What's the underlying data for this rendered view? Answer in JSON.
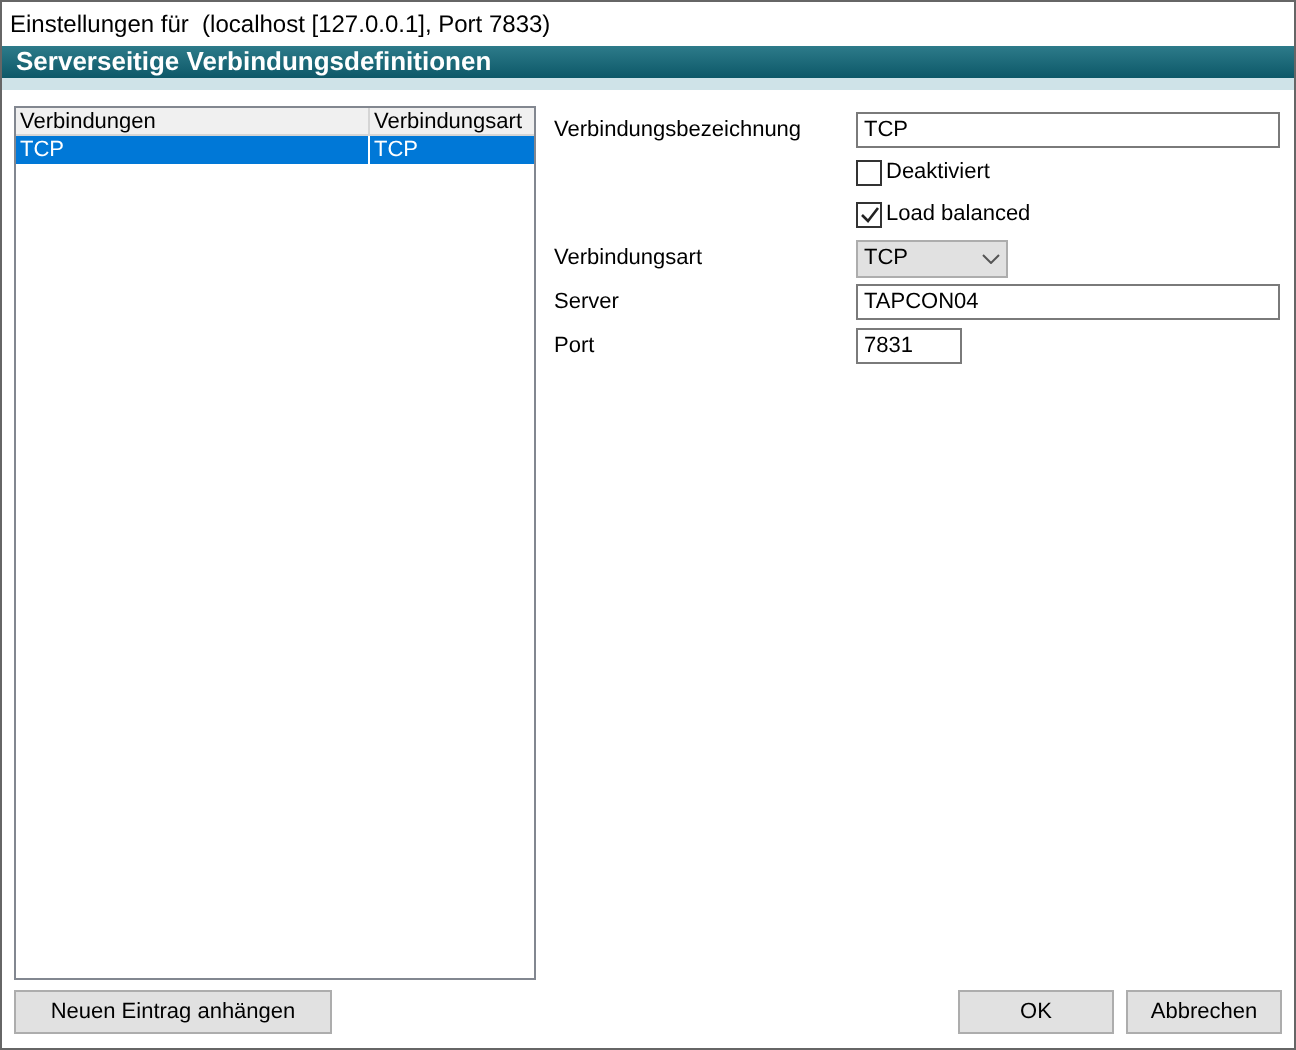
{
  "window": {
    "title": "Einstellungen für  (localhost [127.0.0.1], Port 7833)"
  },
  "header": "Serverseitige Verbindungsdefinitionen",
  "table": {
    "columns": [
      "Verbindungen",
      "Verbindungsart"
    ],
    "rows": [
      {
        "cells": [
          "TCP",
          "TCP"
        ],
        "selected": true
      }
    ]
  },
  "form": [
    {
      "kind": "text",
      "label": "Verbindungsbezeichnung",
      "value": "TCP",
      "wide": true
    },
    {
      "kind": "checkbox",
      "label": "Deaktiviert",
      "checked": false
    },
    {
      "kind": "checkbox",
      "label": "Load balanced",
      "checked": true
    },
    {
      "kind": "select",
      "label": "Verbindungsart",
      "value": "TCP"
    },
    {
      "kind": "text",
      "label": "Server",
      "value": "TAPCON04",
      "wide": true
    },
    {
      "kind": "text",
      "label": "Port",
      "value": "7831",
      "wide": false
    }
  ],
  "buttons": {
    "add": "Neuen Eintrag anhängen",
    "ok": "OK",
    "cancel": "Abbrechen"
  }
}
